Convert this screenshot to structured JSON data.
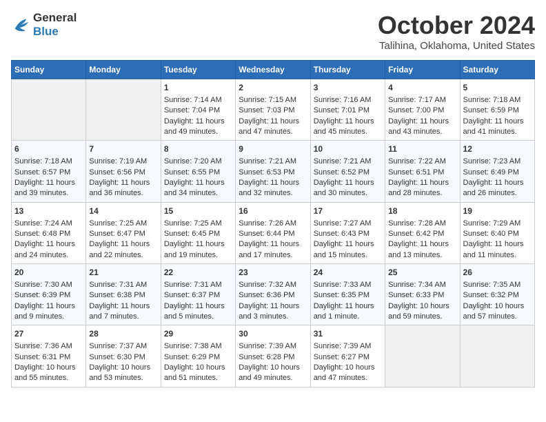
{
  "header": {
    "logo_line1": "General",
    "logo_line2": "Blue",
    "month_title": "October 2024",
    "location": "Talihina, Oklahoma, United States"
  },
  "weekdays": [
    "Sunday",
    "Monday",
    "Tuesday",
    "Wednesday",
    "Thursday",
    "Friday",
    "Saturday"
  ],
  "weeks": [
    [
      {
        "day": "",
        "empty": true
      },
      {
        "day": "",
        "empty": true
      },
      {
        "day": "1",
        "sunrise": "7:14 AM",
        "sunset": "7:04 PM",
        "daylight": "11 hours and 49 minutes."
      },
      {
        "day": "2",
        "sunrise": "7:15 AM",
        "sunset": "7:03 PM",
        "daylight": "11 hours and 47 minutes."
      },
      {
        "day": "3",
        "sunrise": "7:16 AM",
        "sunset": "7:01 PM",
        "daylight": "11 hours and 45 minutes."
      },
      {
        "day": "4",
        "sunrise": "7:17 AM",
        "sunset": "7:00 PM",
        "daylight": "11 hours and 43 minutes."
      },
      {
        "day": "5",
        "sunrise": "7:18 AM",
        "sunset": "6:59 PM",
        "daylight": "11 hours and 41 minutes."
      }
    ],
    [
      {
        "day": "6",
        "sunrise": "7:18 AM",
        "sunset": "6:57 PM",
        "daylight": "11 hours and 39 minutes."
      },
      {
        "day": "7",
        "sunrise": "7:19 AM",
        "sunset": "6:56 PM",
        "daylight": "11 hours and 36 minutes."
      },
      {
        "day": "8",
        "sunrise": "7:20 AM",
        "sunset": "6:55 PM",
        "daylight": "11 hours and 34 minutes."
      },
      {
        "day": "9",
        "sunrise": "7:21 AM",
        "sunset": "6:53 PM",
        "daylight": "11 hours and 32 minutes."
      },
      {
        "day": "10",
        "sunrise": "7:21 AM",
        "sunset": "6:52 PM",
        "daylight": "11 hours and 30 minutes."
      },
      {
        "day": "11",
        "sunrise": "7:22 AM",
        "sunset": "6:51 PM",
        "daylight": "11 hours and 28 minutes."
      },
      {
        "day": "12",
        "sunrise": "7:23 AM",
        "sunset": "6:49 PM",
        "daylight": "11 hours and 26 minutes."
      }
    ],
    [
      {
        "day": "13",
        "sunrise": "7:24 AM",
        "sunset": "6:48 PM",
        "daylight": "11 hours and 24 minutes."
      },
      {
        "day": "14",
        "sunrise": "7:25 AM",
        "sunset": "6:47 PM",
        "daylight": "11 hours and 22 minutes."
      },
      {
        "day": "15",
        "sunrise": "7:25 AM",
        "sunset": "6:45 PM",
        "daylight": "11 hours and 19 minutes."
      },
      {
        "day": "16",
        "sunrise": "7:26 AM",
        "sunset": "6:44 PM",
        "daylight": "11 hours and 17 minutes."
      },
      {
        "day": "17",
        "sunrise": "7:27 AM",
        "sunset": "6:43 PM",
        "daylight": "11 hours and 15 minutes."
      },
      {
        "day": "18",
        "sunrise": "7:28 AM",
        "sunset": "6:42 PM",
        "daylight": "11 hours and 13 minutes."
      },
      {
        "day": "19",
        "sunrise": "7:29 AM",
        "sunset": "6:40 PM",
        "daylight": "11 hours and 11 minutes."
      }
    ],
    [
      {
        "day": "20",
        "sunrise": "7:30 AM",
        "sunset": "6:39 PM",
        "daylight": "11 hours and 9 minutes."
      },
      {
        "day": "21",
        "sunrise": "7:31 AM",
        "sunset": "6:38 PM",
        "daylight": "11 hours and 7 minutes."
      },
      {
        "day": "22",
        "sunrise": "7:31 AM",
        "sunset": "6:37 PM",
        "daylight": "11 hours and 5 minutes."
      },
      {
        "day": "23",
        "sunrise": "7:32 AM",
        "sunset": "6:36 PM",
        "daylight": "11 hours and 3 minutes."
      },
      {
        "day": "24",
        "sunrise": "7:33 AM",
        "sunset": "6:35 PM",
        "daylight": "11 hours and 1 minute."
      },
      {
        "day": "25",
        "sunrise": "7:34 AM",
        "sunset": "6:33 PM",
        "daylight": "10 hours and 59 minutes."
      },
      {
        "day": "26",
        "sunrise": "7:35 AM",
        "sunset": "6:32 PM",
        "daylight": "10 hours and 57 minutes."
      }
    ],
    [
      {
        "day": "27",
        "sunrise": "7:36 AM",
        "sunset": "6:31 PM",
        "daylight": "10 hours and 55 minutes."
      },
      {
        "day": "28",
        "sunrise": "7:37 AM",
        "sunset": "6:30 PM",
        "daylight": "10 hours and 53 minutes."
      },
      {
        "day": "29",
        "sunrise": "7:38 AM",
        "sunset": "6:29 PM",
        "daylight": "10 hours and 51 minutes."
      },
      {
        "day": "30",
        "sunrise": "7:39 AM",
        "sunset": "6:28 PM",
        "daylight": "10 hours and 49 minutes."
      },
      {
        "day": "31",
        "sunrise": "7:39 AM",
        "sunset": "6:27 PM",
        "daylight": "10 hours and 47 minutes."
      },
      {
        "day": "",
        "empty": true
      },
      {
        "day": "",
        "empty": true
      }
    ]
  ],
  "labels": {
    "sunrise": "Sunrise: ",
    "sunset": "Sunset: ",
    "daylight": "Daylight: "
  }
}
